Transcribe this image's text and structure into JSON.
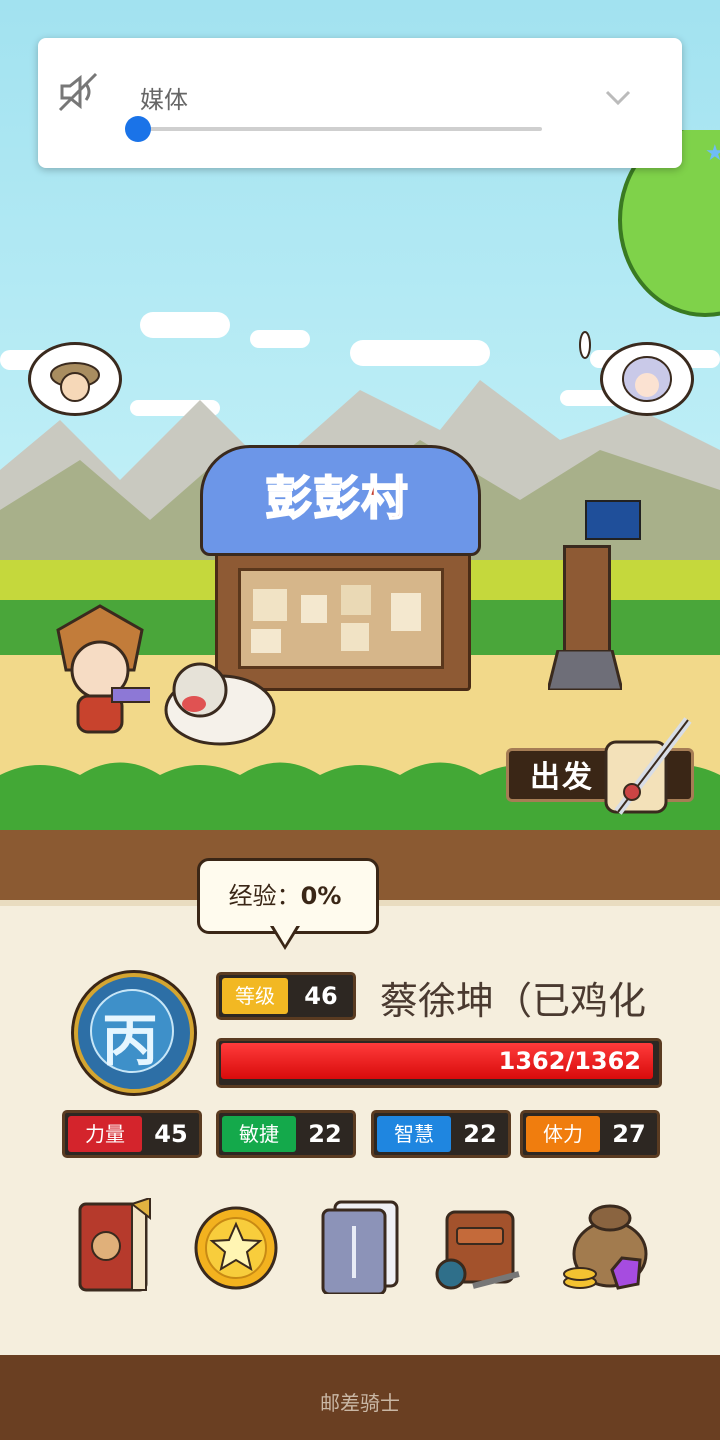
{
  "volume_popup": {
    "label": "媒体",
    "icon": "volume-mute-icon",
    "level": 0,
    "expand_icon": "chevron-down-icon",
    "accent": "#1a73e8"
  },
  "scene": {
    "village_name": "彭彭村",
    "depart_label": "出发"
  },
  "character": {
    "exp_label": "经验：",
    "exp_value": "0%",
    "rank_char": "丙",
    "level_label": "等级",
    "level_value": "46",
    "name": "蔡徐坤（已鸡化",
    "hp_text": "1362/1362",
    "hp_fraction": 1.0,
    "stats": [
      {
        "label": "力量",
        "value": "45",
        "color": "#d4242c"
      },
      {
        "label": "敏捷",
        "value": "22",
        "color": "#14a94b"
      },
      {
        "label": "智慧",
        "value": "22",
        "color": "#1f86e0"
      },
      {
        "label": "体力",
        "value": "27",
        "color": "#f07d0e"
      }
    ]
  },
  "menu": [
    {
      "name": "book-icon"
    },
    {
      "name": "star-coin-icon"
    },
    {
      "name": "cards-icon"
    },
    {
      "name": "backpack-icon"
    },
    {
      "name": "treasure-bag-icon"
    }
  ],
  "footer": {
    "label": "邮差骑士"
  }
}
